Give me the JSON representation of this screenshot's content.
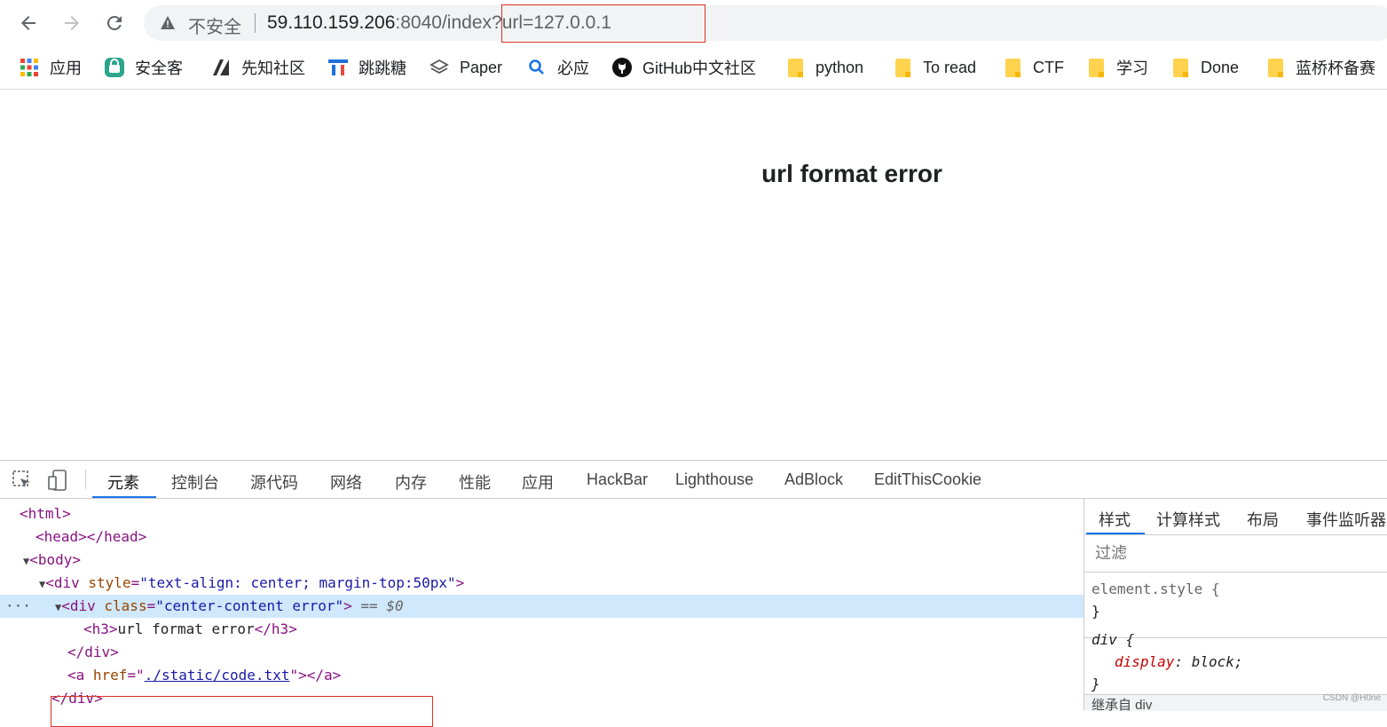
{
  "browser": {
    "insecure_label": "不安全",
    "url_host": "59.110.159.206",
    "url_rest": ":8040/index?url=127.0.0.1"
  },
  "bookmarks": [
    {
      "label": "应用",
      "icon": "apps-grid-icon"
    },
    {
      "label": "安全客",
      "icon": "anquanke-icon"
    },
    {
      "label": "先知社区",
      "icon": "xianzhi-icon"
    },
    {
      "label": "跳跳糖",
      "icon": "tiaotiaotang-icon"
    },
    {
      "label": "Paper",
      "icon": "paper-stack-icon"
    },
    {
      "label": "必应",
      "icon": "bing-search-icon"
    },
    {
      "label": "GitHub中文社区",
      "icon": "github-icon"
    },
    {
      "label": "python",
      "icon": "folder-icon"
    },
    {
      "label": "To read",
      "icon": "folder-icon"
    },
    {
      "label": "CTF",
      "icon": "folder-icon"
    },
    {
      "label": "学习",
      "icon": "folder-icon"
    },
    {
      "label": "Done",
      "icon": "folder-icon"
    },
    {
      "label": "蓝桥杯备赛",
      "icon": "folder-icon"
    }
  ],
  "page": {
    "heading": "url format error"
  },
  "devtools": {
    "tabs": [
      "元素",
      "控制台",
      "源代码",
      "网络",
      "内存",
      "性能",
      "应用",
      "HackBar",
      "Lighthouse",
      "AdBlock",
      "EditThisCookie"
    ],
    "elements": {
      "html_open": "<html>",
      "head": "<head></head>",
      "body_open": "<body>",
      "div_open": "<div",
      "div_style_attr": "style",
      "div_style_val": "\"text-align: center; margin-top:50px\"",
      "gt": ">",
      "inner_div_open": "<div",
      "inner_div_class_attr": "class",
      "inner_div_class_val": "\"center-content error\"",
      "selected_hint": "== $0",
      "h3_open": "<h3>",
      "h3_text": "url format error",
      "h3_close": "</h3>",
      "div_close": "</div>",
      "a_open": "<a",
      "a_href_attr": "href",
      "a_href_val": "./static/code.txt",
      "a_close": "></a>",
      "outer_div_close": "</div>",
      "ellipsis": "···"
    },
    "styles": {
      "tabs": [
        "样式",
        "计算样式",
        "布局",
        "事件监听器"
      ],
      "filter_placeholder": "过滤",
      "element_style_selector": "element.style {",
      "close_brace": "}",
      "div_selector": "div {",
      "prop_name": "display",
      "prop_value": "block;",
      "inherited_label": "继承自 div"
    },
    "watermark": "CSDN @H0ne"
  }
}
